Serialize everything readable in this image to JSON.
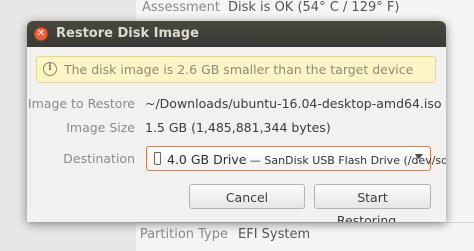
{
  "parent": {
    "assessment_label": "Assessment",
    "assessment_value": "Disk is OK (54° C / 129° F)",
    "partition_type_label": "Partition Type",
    "partition_type_value": "EFI System"
  },
  "dialog": {
    "title": "Restore Disk Image",
    "close_icon": "close-icon",
    "info_icon": "info-icon",
    "info_message": "The disk image is 2.6 GB smaller than the target device",
    "image_to_restore_label": "Image to Restore",
    "image_to_restore_value": "~/Downloads/ubuntu-16.04-desktop-amd64.iso",
    "image_size_label": "Image Size",
    "image_size_value": "1.5 GB (1,485,881,344 bytes)",
    "destination_label": "Destination",
    "destination_main": "4.0 GB Drive",
    "destination_detail": " — SanDisk USB Flash Drive (/dev/sdc)",
    "cancel_label": "Cancel",
    "start_label": "Start Restoring..."
  },
  "colors": {
    "titlebar": "#3c3b37",
    "close_button": "#e8613a",
    "infobar_bg": "#fcf5c5",
    "focus_border": "#e07a4f"
  }
}
